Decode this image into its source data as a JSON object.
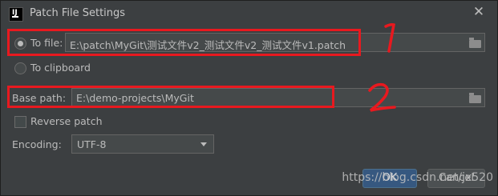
{
  "window": {
    "title": "Patch File Settings",
    "close_glyph": "✕",
    "app_icon_text": "IJ"
  },
  "to_file": {
    "label": "To file:",
    "value": "E:\\patch\\MyGit\\测试文件v2_测试文件v2_测试文件v1.patch",
    "selected": true
  },
  "to_clipboard": {
    "label": "To clipboard",
    "selected": false
  },
  "base_path": {
    "label": "Base path:",
    "value": "E:\\demo-projects\\MyGit"
  },
  "reverse_patch": {
    "label": "Reverse patch",
    "checked": false
  },
  "encoding": {
    "label": "Encoding:",
    "value": "UTF-8"
  },
  "buttons": {
    "ok": "OK",
    "cancel": "Cancel"
  },
  "watermark": "https://blog.csdn.net/jx520",
  "annotations": {
    "handwritten_1": "1",
    "handwritten_2": "2",
    "color": "#e8191f"
  }
}
